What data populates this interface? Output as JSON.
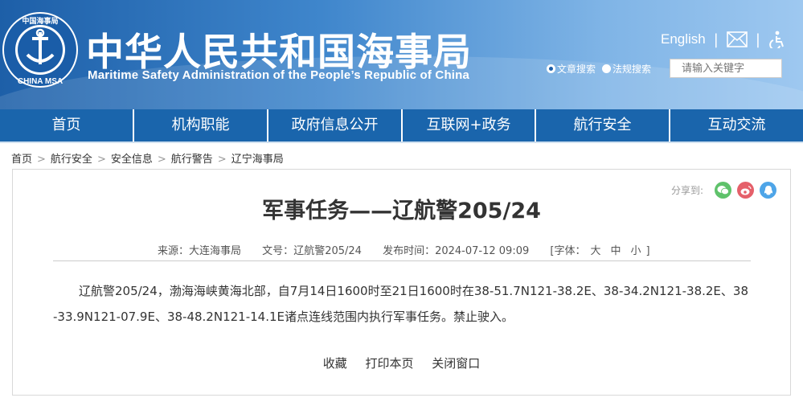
{
  "header": {
    "title_cn": "中华人民共和国海事局",
    "title_en": "Maritime Safety Administration of the People’s Republic of China",
    "logo_text_top": "中国海事局",
    "logo_text_bottom": "CHINA MSA",
    "english_link": "English",
    "search": {
      "option_article": "文章搜索",
      "option_law": "法规搜索",
      "placeholder": "请输入关键字"
    }
  },
  "nav": {
    "items": [
      {
        "label": "首页"
      },
      {
        "label": "机构职能"
      },
      {
        "label": "政府信息公开"
      },
      {
        "label": "互联网+政务"
      },
      {
        "label": "航行安全"
      },
      {
        "label": "互动交流"
      }
    ]
  },
  "breadcrumb": {
    "items": [
      "首页",
      "航行安全",
      "安全信息",
      "航行警告",
      "辽宁海事局"
    ]
  },
  "share": {
    "label": "分享到:"
  },
  "article": {
    "title": "军事任务——辽航警205/24",
    "source_label": "来源：",
    "source": "大连海事局",
    "docno_label": "文号：",
    "docno": "辽航警205/24",
    "date_label": "发布时间：",
    "date": "2024-07-12 09:09",
    "font_label": "[字体：",
    "font_large": "大",
    "font_medium": "中",
    "font_small": "小",
    "font_end": "]",
    "body": "辽航警205/24，渤海海峡黄海北部，自7月14日1600时至21日1600时在38-51.7N121-38.2E、38-34.2N121-38.2E、38-33.9N121-07.9E、38-48.2N121-14.1E诸点连线范围内执行军事任务。禁止驶入。"
  },
  "actions": {
    "favorite": "收藏",
    "print": "打印本页",
    "close": "关闭窗口"
  },
  "colors": {
    "nav_bg": "#1a65ac",
    "header_dark": "#1d5fa8",
    "header_light": "#9ec8f0",
    "wechat": "#5fc26b",
    "weibo": "#e5606a",
    "qq": "#4ea5e8"
  },
  "icons": {
    "mail": "mail-icon",
    "accessibility": "accessibility-icon",
    "wechat": "wechat-icon",
    "weibo": "weibo-icon",
    "qq": "qq-icon"
  }
}
